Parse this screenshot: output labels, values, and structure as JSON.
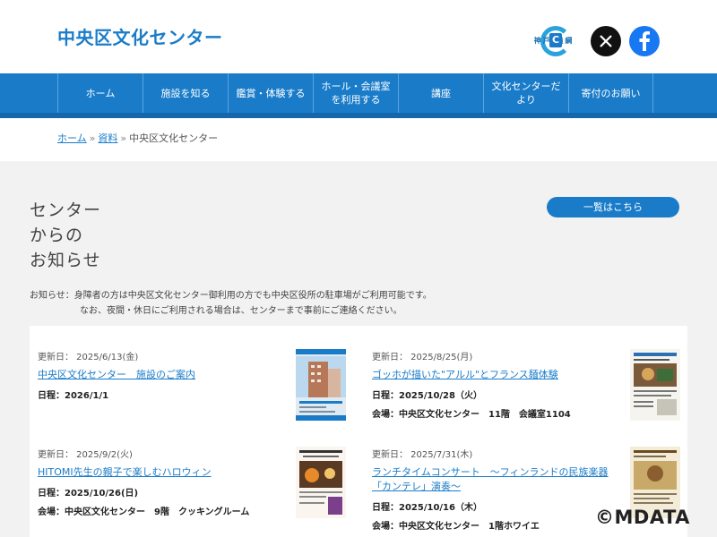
{
  "header": {
    "site_title": "中央区文化センター",
    "kobe_logo_text": "神戸 横綱",
    "kobe_logo_c": "C"
  },
  "nav": {
    "items": [
      {
        "label": "ホーム"
      },
      {
        "label": "施設を知る"
      },
      {
        "label": "鑑賞・体験する"
      },
      {
        "label": "ホール・会議室を利用する"
      },
      {
        "label": "講座"
      },
      {
        "label": "文化センターだより"
      },
      {
        "label": "寄付のお願い"
      }
    ]
  },
  "breadcrumb": {
    "home": "ホーム",
    "sep": "»",
    "parent": "資料",
    "current": "中央区文化センター"
  },
  "section": {
    "title_line1": "センター",
    "title_line2": "からの",
    "title_line3": "お知らせ",
    "list_button": "一覧はこちら"
  },
  "notice": {
    "line1": "お知らせ：身障者の方は中央区文化センター御利用の方でも中央区役所の駐車場がご利用可能です。",
    "line2": "なお、夜間・休日にご利用される場合は、センターまで事前にご連絡ください。"
  },
  "news": [
    {
      "updated": "更新日： 2025/6/13(金)",
      "title": "中央区文化センター　施設のご案内",
      "info1": "日程：2026/1/1",
      "info2": ""
    },
    {
      "updated": "更新日： 2025/8/25(月)",
      "title": "ゴッホが描いた\"アルル\"とフランス麺体験",
      "info1": "日程：2025/10/28（火）",
      "info2": "会場：中央区文化センター　11階　会議室1104"
    },
    {
      "updated": "更新日： 2025/9/2(火)",
      "title": "HITOMI先生の親子で楽しむハロウィン",
      "info1": "日程：2025/10/26(日)",
      "info2": "会場：中央区文化センター　9階　クッキングルーム"
    },
    {
      "updated": "更新日： 2025/7/31(木)",
      "title": "ランチタイムコンサート　～フィンランドの民族楽器「カンテレ」演奏～",
      "info1": "日程：2025/10/16（木）",
      "info2": "会場：中央区文化センター　1階ホワイエ"
    }
  ],
  "watermark": "©MDATA",
  "colors": {
    "brand": "#1a7cc9",
    "background": "#f2f2f2"
  }
}
